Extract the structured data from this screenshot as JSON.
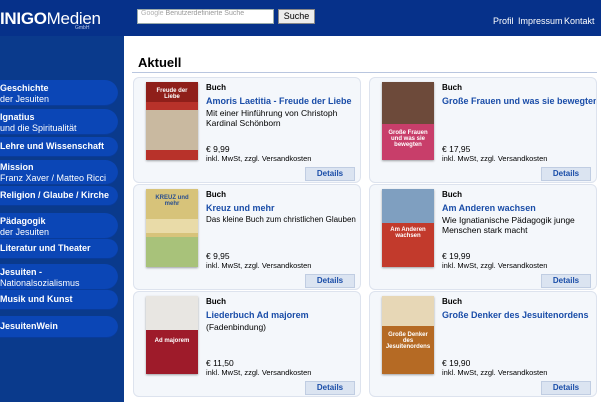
{
  "header": {
    "logo_main": "INIGO",
    "logo_light": "Medien",
    "logo_sub": "GmbH",
    "search_placeholder": "Benutzerdefinierte Suche",
    "search_brand": "Google",
    "search_button": "Suche",
    "nav": [
      "Profil",
      "Impressum",
      "Kontakt"
    ]
  },
  "sidebar": {
    "items": [
      {
        "bold": "Geschichte",
        "sub": "der Jesuiten"
      },
      {
        "bold": "Ignatius",
        "sub": "und die Spiritualität"
      },
      {
        "bold": "Lehre und Wissenschaft",
        "sub": ""
      },
      {
        "bold": "Mission",
        "sub": "Franz Xaver / Matteo Ricci"
      },
      {
        "bold": "Religion / Glaube / Kirche",
        "sub": ""
      },
      {
        "bold": "Pädagogik",
        "sub": "der Jesuiten"
      },
      {
        "bold": "Literatur und Theater",
        "sub": ""
      },
      {
        "bold": "Jesuiten -",
        "sub": "Nationalsozialismus"
      },
      {
        "bold": "Musik und Kunst",
        "sub": ""
      },
      {
        "bold": "JesuitenWein",
        "sub": ""
      }
    ]
  },
  "main": {
    "title": "Aktuell",
    "products": [
      {
        "label": "Buch",
        "title": "Amoris Laetitia - Freude der Liebe",
        "desc": "Mit einer Hinführung von Christoph Kardinal Schönborn",
        "price": "€ 9,99",
        "tax": "inkl. MwSt, zzgl. Versandkosten",
        "button": "Details",
        "cover_color": "#b8322a",
        "cover_text": "Freude der Liebe"
      },
      {
        "label": "Buch",
        "title": "Große Frauen und was sie bewegten",
        "desc": "",
        "price": "€ 17,95",
        "tax": "inkl. MwSt, zzgl. Versandkosten",
        "button": "Details",
        "cover_color": "#c83e6a",
        "cover_text": "Große Frauen und was sie bewegten"
      },
      {
        "label": "Buch",
        "title": "Kreuz und mehr",
        "desc": "Das kleine Buch zum christlichen Glauben",
        "price": "€ 9,95",
        "tax": "inkl. MwSt, zzgl. Versandkosten",
        "button": "Details",
        "cover_color": "#d7c37a",
        "cover_text": "KREUZ und mehr"
      },
      {
        "label": "Buch",
        "title": "Am Anderen wachsen",
        "desc": "Wie Ignatianische Pädagogik junge Menschen stark macht",
        "price": "€ 19,99",
        "tax": "inkl. MwSt, zzgl. Versandkosten",
        "button": "Details",
        "cover_color": "#c23a2c",
        "cover_text": "Am Anderen wachsen"
      },
      {
        "label": "Buch",
        "title": "Liederbuch Ad majorem",
        "desc": "(Fadenbindung)",
        "price": "€ 11,50",
        "tax": "inkl. MwSt, zzgl. Versandkosten",
        "button": "Details",
        "cover_color": "#9e1b2a",
        "cover_text": "Ad majorem"
      },
      {
        "label": "Buch",
        "title": "Große Denker des Jesuitenordens",
        "desc": "",
        "price": "€ 19,90",
        "tax": "inkl. MwSt, zzgl. Versandkosten",
        "button": "Details",
        "cover_color": "#b56a24",
        "cover_text": "Große Denker des Jesuitenordens"
      }
    ]
  },
  "colors": {
    "header_bg": "#06318a",
    "nav_item": "#0b46b6",
    "link_blue": "#1a4da8"
  }
}
